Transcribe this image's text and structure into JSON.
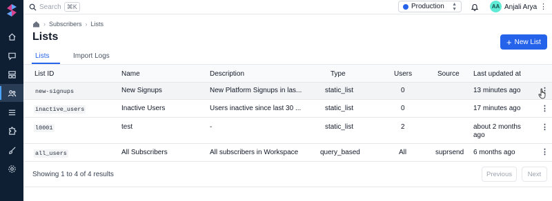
{
  "topbar": {
    "search_placeholder": "Search",
    "search_shortcut": "⌘K",
    "environment": "Production",
    "environment_color": "#2563eb",
    "user_initials": "AA",
    "user_name": "Anjali Arya"
  },
  "breadcrumb": [
    "Subscribers",
    "Lists"
  ],
  "page": {
    "title": "Lists",
    "new_button": "New List"
  },
  "tabs": [
    {
      "label": "Lists",
      "active": true
    },
    {
      "label": "Import Logs",
      "active": false
    }
  ],
  "table": {
    "columns": [
      "List ID",
      "Name",
      "Description",
      "Type",
      "Users",
      "Source",
      "Last updated at"
    ],
    "rows": [
      {
        "id": "new-signups",
        "name": "New Signups",
        "description": "New Platform Signups in las...",
        "type": "static_list",
        "users": "0",
        "source": "",
        "updated": "13 minutes ago",
        "updated2": ""
      },
      {
        "id": "inactive_users",
        "name": "Inactive Users",
        "description": "Users inactive since last 30 ...",
        "type": "static_list",
        "users": "0",
        "source": "",
        "updated": "17 minutes ago",
        "updated2": ""
      },
      {
        "id": "l0001",
        "name": "test",
        "description": "-",
        "type": "static_list",
        "users": "2",
        "source": "",
        "updated": "about 2 months",
        "updated2": "ago"
      },
      {
        "id": "all_users",
        "name": "All Subscribers",
        "description": "All subscribers in Workspace",
        "type": "query_based",
        "users": "All",
        "source": "suprsend",
        "updated": "6 months ago",
        "updated2": ""
      }
    ]
  },
  "footer": {
    "results": "Showing 1 to 4 of 4 results",
    "previous": "Previous",
    "next": "Next"
  },
  "colors": {
    "sidebar": "#0f1f33",
    "accent": "#2563eb"
  },
  "icons": [
    "logo-icon",
    "home-icon",
    "chat-icon",
    "template-icon",
    "subscribers-icon",
    "list-icon",
    "integrations-icon",
    "brush-icon",
    "settings-icon",
    "search-icon",
    "bell-icon",
    "kebab-icon",
    "plus-icon"
  ]
}
